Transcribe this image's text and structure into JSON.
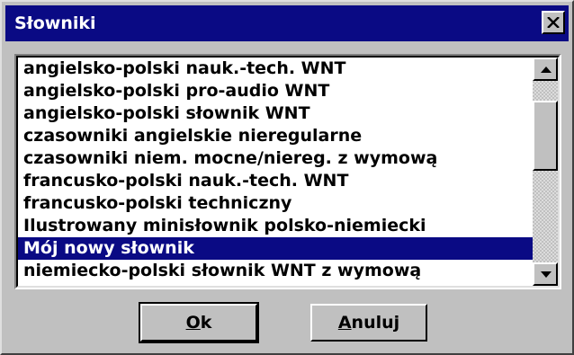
{
  "window": {
    "title": "Słowniki"
  },
  "dictionaries": [
    "angielsko-polski nauk.-tech. WNT",
    "angielsko-polski pro-audio WNT",
    "angielsko-polski słownik WNT",
    "czasowniki angielskie nieregularne",
    "czasowniki niem. mocne/niereg. z wymową",
    "francusko-polski nauk.-tech. WNT",
    "francusko-polski techniczny",
    "Ilustrowany minisłownik polsko-niemiecki",
    "Mój nowy słownik",
    "niemiecko-polski słownik WNT z wymową"
  ],
  "selected_dictionary": "Mój nowy słownik",
  "buttons": {
    "ok": "Ok",
    "cancel": "Anuluj"
  },
  "icons": {
    "close": "close-icon",
    "scroll_up": "arrow-up-icon",
    "scroll_down": "arrow-down-icon"
  },
  "colors": {
    "titlebar": "#0a0a84",
    "selection": "#0a0a84",
    "face": "#c0c0c0"
  }
}
